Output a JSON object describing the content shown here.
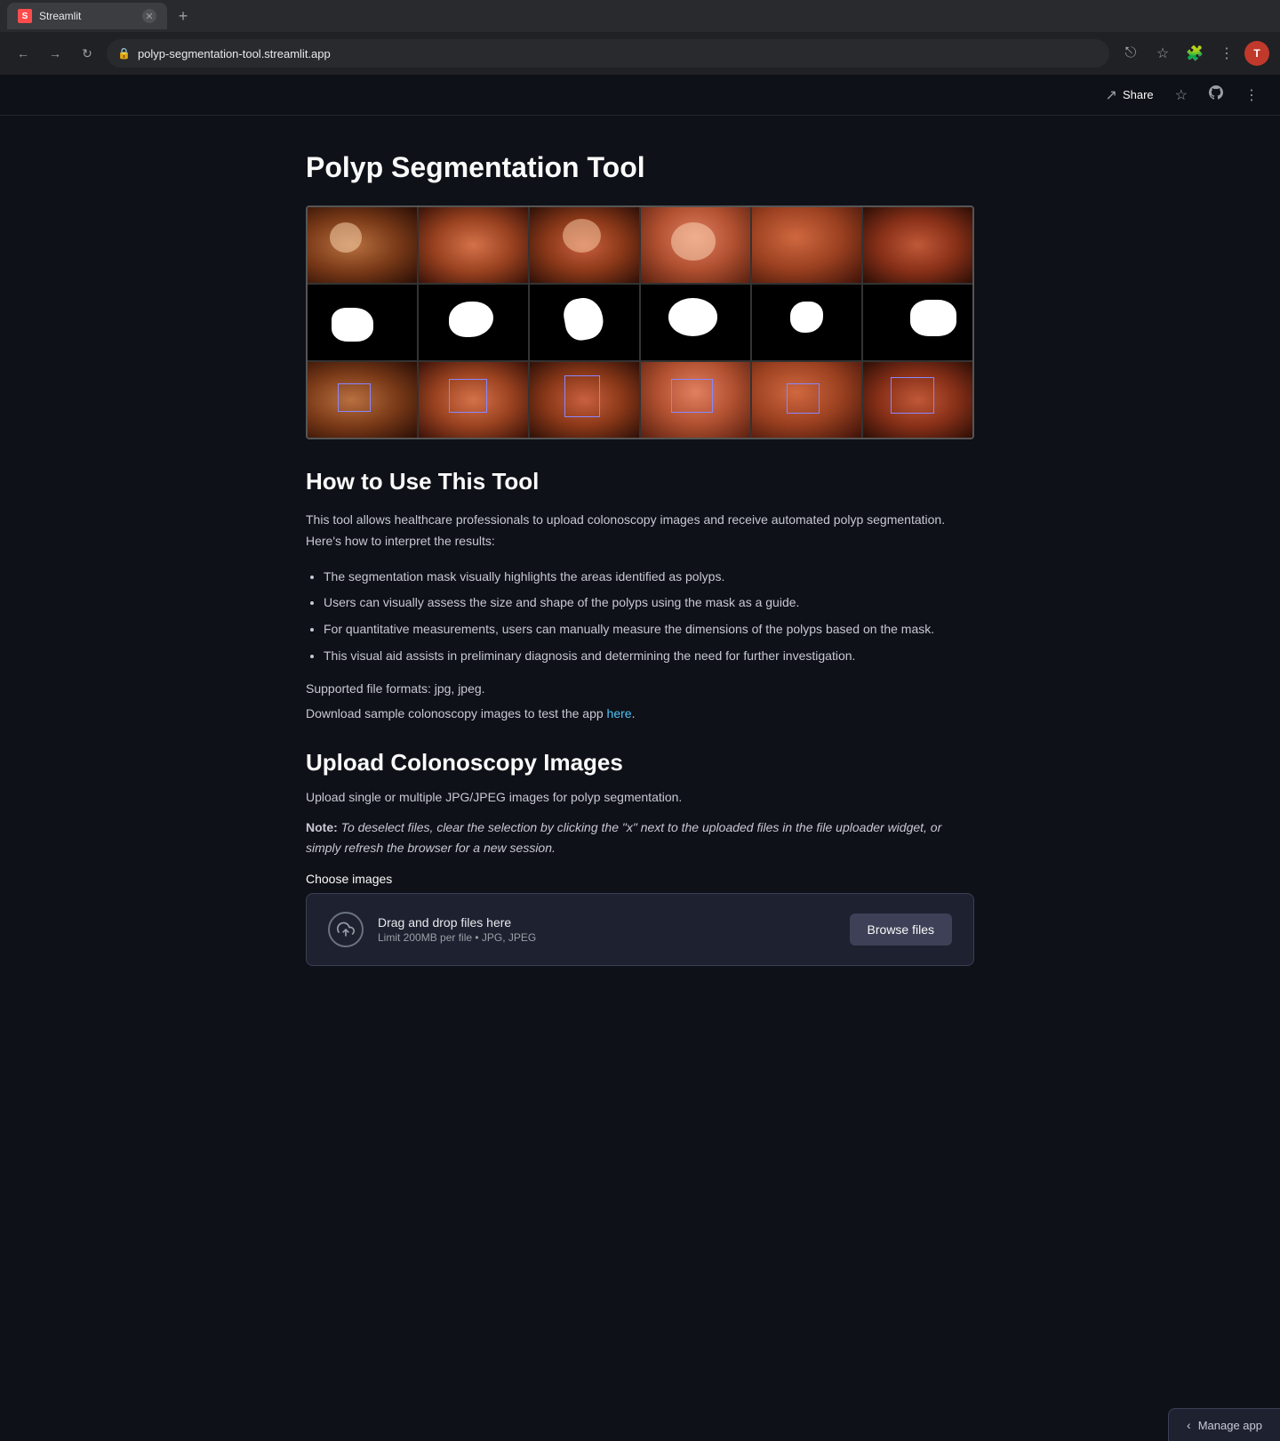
{
  "browser": {
    "tab_label": "Streamlit",
    "url": "polyp-segmentation-tool.streamlit.app",
    "new_tab_label": "+",
    "nav_back": "←",
    "nav_forward": "→",
    "nav_refresh": "↻",
    "profile_initial": "T"
  },
  "topbar": {
    "share_label": "Share",
    "manage_app_label": "Manage app"
  },
  "main": {
    "page_title": "Polyp Segmentation Tool",
    "how_to_title": "How to Use This Tool",
    "intro_text": "This tool allows healthcare professionals to upload colonoscopy images and receive automated polyp segmentation. Here's how to interpret the results:",
    "bullets": [
      "The segmentation mask visually highlights the areas identified as polyps.",
      "Users can visually assess the size and shape of the polyps using the mask as a guide.",
      "For quantitative measurements, users can manually measure the dimensions of the polyps based on the mask.",
      "This visual aid assists in preliminary diagnosis and determining the need for further investigation."
    ],
    "supported_formats": "Supported file formats: jpg, jpeg.",
    "download_text": "Download sample colonoscopy images to test the app ",
    "download_link_text": "here",
    "upload_title": "Upload Colonoscopy Images",
    "upload_desc": "Upload single or multiple JPG/JPEG images for polyp segmentation.",
    "note_label": "Note:",
    "note_text": " To deselect files, clear the selection by clicking the \"x\" next to the uploaded files in the file uploader widget, or simply refresh the browser for a new session.",
    "choose_label": "Choose images",
    "drag_drop_text": "Drag and drop files here",
    "limit_text": "Limit 200MB per file • JPG, JPEG",
    "browse_files_label": "Browse files"
  }
}
